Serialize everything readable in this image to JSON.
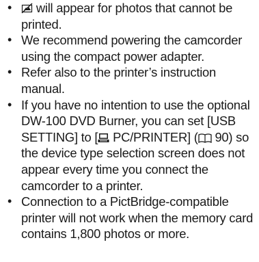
{
  "notes": [
    {
      "icon_name": "no-print-icon",
      "text": " will appear for photos that cannot be printed."
    },
    {
      "text": "We recommend powering the camcorder using the compact power adapter."
    },
    {
      "text": "Refer also to the printer’s instruction manual."
    },
    {
      "text_before": "If you have no intention to use the optional DW-100 DVD Burner, you can set [USB SETTING] to [",
      "pc_icon_name": "pc-printer-icon",
      "text_mid": " PC/PRINTER] (",
      "book_icon_name": "book-icon",
      "text_after": " 90) so the device type selection screen does not appear every time you connect the camcorder to a printer."
    },
    {
      "text": "Connection to a PictBridge-compatible printer will not work when the memory card contains 1,800 photos or more."
    }
  ],
  "bullet": "•"
}
